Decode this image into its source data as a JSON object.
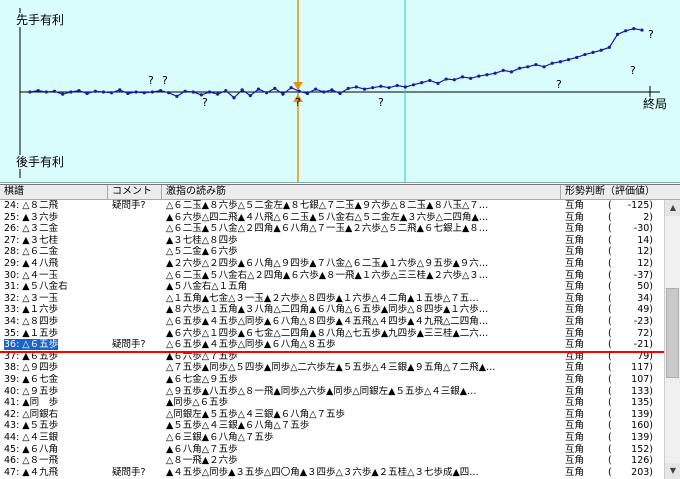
{
  "graph": {
    "top_label": "先手有利",
    "bottom_label": "後手有利",
    "end_label": "終局",
    "marker_symbol": "?",
    "colors": {
      "background": "#d8fdfc",
      "line": "#1a1aa8",
      "current": "#e89010",
      "cursor": "#30c8c8",
      "mark": "#e02020"
    }
  },
  "table": {
    "headers": {
      "move": "棋譜",
      "comment": "コメント",
      "pv": "激指の読み筋",
      "eval": "形勢判断（評価値）"
    },
    "rows": [
      {
        "move": "24: △８二飛",
        "comment": "疑問手?",
        "pv": "△６二玉▲８六歩△５二金左▲８七銀△７二玉▲９六歩△８二玉▲８八玉△７…",
        "eval": "互角",
        "score": "-125"
      },
      {
        "move": "25: ▲３六歩",
        "comment": "",
        "pv": "▲６六歩△四二飛▲４八飛△６二玉▲５八金右△５二金左▲３六歩△二四角▲…",
        "eval": "互角",
        "score": "2"
      },
      {
        "move": "26: △３二金",
        "comment": "",
        "pv": "△６二玉▲５八金△２四角▲６八角△７一玉▲２六歩△５二飛▲６七銀上▲８…",
        "eval": "互角",
        "score": "-30"
      },
      {
        "move": "27: ▲３七桂",
        "comment": "",
        "pv": "▲３七桂△８四歩",
        "eval": "互角",
        "score": "14"
      },
      {
        "move": "28: △６二金",
        "comment": "",
        "pv": "△５二金▲６六歩",
        "eval": "互角",
        "score": "12"
      },
      {
        "move": "29: ▲４八飛",
        "comment": "",
        "pv": "▲２六歩△２四歩▲６八角△９四歩▲７八金△６二玉▲１六歩△９五歩▲９六…",
        "eval": "互角",
        "score": "12"
      },
      {
        "move": "30: △４一玉",
        "comment": "",
        "pv": "△６二玉▲５八金右△２四角▲６六歩▲８一飛▲１六歩△三三桂▲２六歩△３…",
        "eval": "互角",
        "score": "-37"
      },
      {
        "move": "31: ▲５八金右",
        "comment": "",
        "pv": "▲５八金右△１五角",
        "eval": "互角",
        "score": "50"
      },
      {
        "move": "32: △３一玉",
        "comment": "",
        "pv": "△１五角▲七金△３一玉▲２六歩△８四歩▲１六歩△４二角▲１五歩△７五…",
        "eval": "互角",
        "score": "34"
      },
      {
        "move": "33: ▲１六歩",
        "comment": "",
        "pv": "▲８六歩△１五角▲３八角△二四角▲６八角△６五歩▲同歩△８四歩▲１六歩…",
        "eval": "互角",
        "score": "49"
      },
      {
        "move": "34: △８四歩",
        "comment": "",
        "pv": "△６五歩▲４五歩△同歩▲６八角△８四歩▲４五飛△４四歩▲４九飛△二四角…",
        "eval": "互角",
        "score": "-23"
      },
      {
        "move": "35: ▲１五歩",
        "comment": "",
        "pv": "▲６六歩△１四歩▲６七金△二四角▲８八角△七五歩▲九四歩▲三三桂▲二六…",
        "eval": "互角",
        "score": "72"
      },
      {
        "move": "36: △６五歩",
        "comment": "疑問手?",
        "pv": "△６五歩▲４五歩△同歩▲６八角△８五歩",
        "eval": "互角",
        "score": "-21"
      },
      {
        "move": "37: ▲６五歩",
        "comment": "",
        "pv": "▲６六歩△７五歩",
        "eval": "互角",
        "score": "79"
      },
      {
        "move": "38: △９四歩",
        "comment": "",
        "pv": "△７五歩▲同歩△５四歩▲同歩△二六歩左▲５五歩△４三銀▲９五角△７二飛▲…",
        "eval": "互角",
        "score": "117"
      },
      {
        "move": "39: ▲６七金",
        "comment": "",
        "pv": "▲６七金△９五歩",
        "eval": "互角",
        "score": "107"
      },
      {
        "move": "40: △９五歩",
        "comment": "",
        "pv": "△９五歩▲八五歩△８一飛▲同歩△六歩▲同歩△同銀左▲５五歩△４三銀▲…",
        "eval": "互角",
        "score": "133"
      },
      {
        "move": "41: ▲同　歩",
        "comment": "",
        "pv": "▲同歩△６五歩",
        "eval": "互角",
        "score": "135"
      },
      {
        "move": "42: △同銀右",
        "comment": "",
        "pv": "△同銀左▲５五歩△４三銀▲６八角△７五歩",
        "eval": "互角",
        "score": "139"
      },
      {
        "move": "43: ▲５五歩",
        "comment": "",
        "pv": "▲５五歩△４三銀▲６八角△７五歩",
        "eval": "互角",
        "score": "160"
      },
      {
        "move": "44: △４三銀",
        "comment": "",
        "pv": "△６三銀▲６八角△７五歩",
        "eval": "互角",
        "score": "139"
      },
      {
        "move": "45: ▲６八角",
        "comment": "",
        "pv": "▲６八角△７五歩",
        "eval": "互角",
        "score": "152"
      },
      {
        "move": "46: △８一飛",
        "comment": "",
        "pv": "△８一飛▲２六歩",
        "eval": "互角",
        "score": "126"
      },
      {
        "move": "47: ▲４九飛",
        "comment": "疑問手?",
        "pv": "▲４五歩△同歩▲３五歩△四〇角▲３四歩△３六歩▲２五桂△３七歩成▲四…",
        "eval": "互角",
        "score": "203"
      }
    ]
  },
  "graph_series": {
    "values": [
      0,
      2,
      0,
      1,
      -3,
      0,
      2,
      -2,
      1,
      0,
      -1,
      3,
      -2,
      0,
      -1,
      0,
      2,
      -1,
      -6,
      1,
      0,
      -4,
      0,
      -3,
      2,
      -8,
      3,
      -5,
      4,
      -1,
      5,
      -3,
      6,
      1,
      -2,
      4,
      0,
      3,
      -2,
      5,
      7,
      4,
      6,
      8,
      6,
      9,
      7,
      10,
      13,
      16,
      12,
      18,
      17,
      21,
      19,
      22,
      24,
      26,
      30,
      28,
      33,
      35,
      38,
      35,
      40,
      42,
      45,
      48,
      52,
      55,
      58,
      62,
      80,
      85,
      88,
      86
    ]
  }
}
